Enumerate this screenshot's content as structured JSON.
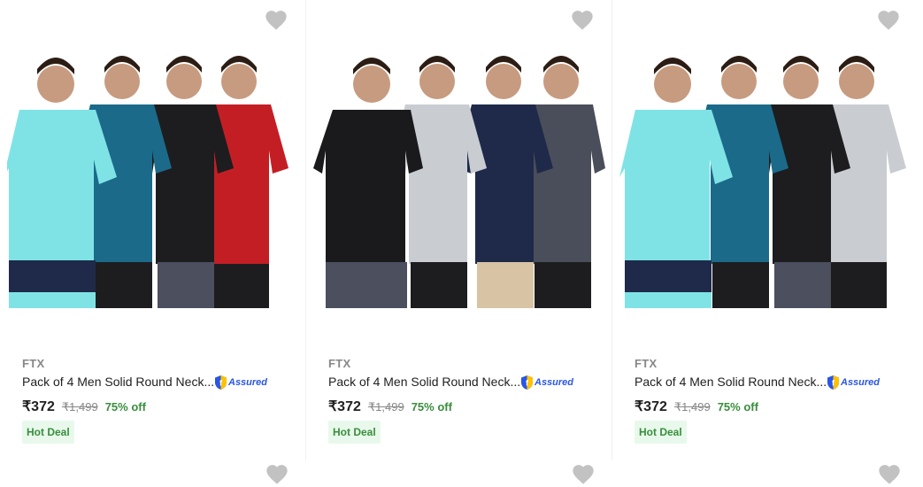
{
  "colors": {
    "heart": "#c2c2c2",
    "price_off": "#388e3c",
    "assured_blue": "#2a55e5",
    "muted": "#878787",
    "badge_bg": "#e8f9ec"
  },
  "products": [
    {
      "brand": "FTX",
      "title": "Pack of 4 Men Solid Round Neck...",
      "assured_label": "Assured",
      "price": "₹372",
      "mrp": "₹1,499",
      "discount": "75% off",
      "badge": "Hot Deal",
      "image_icon": "tshirt-pack-image",
      "shirt_colors": [
        "#7fe3e6",
        "#1b6a8a",
        "#1d1d1f",
        "#c41e25"
      ]
    },
    {
      "brand": "FTX",
      "title": "Pack of 4 Men Solid Round Neck...",
      "assured_label": "Assured",
      "price": "₹372",
      "mrp": "₹1,499",
      "discount": "75% off",
      "badge": "Hot Deal",
      "image_icon": "tshirt-pack-image",
      "shirt_colors": [
        "#1a1a1c",
        "#c9cdd2",
        "#1f2a4a",
        "#4a4e5a"
      ]
    },
    {
      "brand": "FTX",
      "title": "Pack of 4 Men Solid Round Neck...",
      "assured_label": "Assured",
      "price": "₹372",
      "mrp": "₹1,499",
      "discount": "75% off",
      "badge": "Hot Deal",
      "image_icon": "tshirt-pack-image",
      "shirt_colors": [
        "#7fe3e6",
        "#1b6a8a",
        "#1d1d1f",
        "#c9cdd2"
      ]
    }
  ]
}
